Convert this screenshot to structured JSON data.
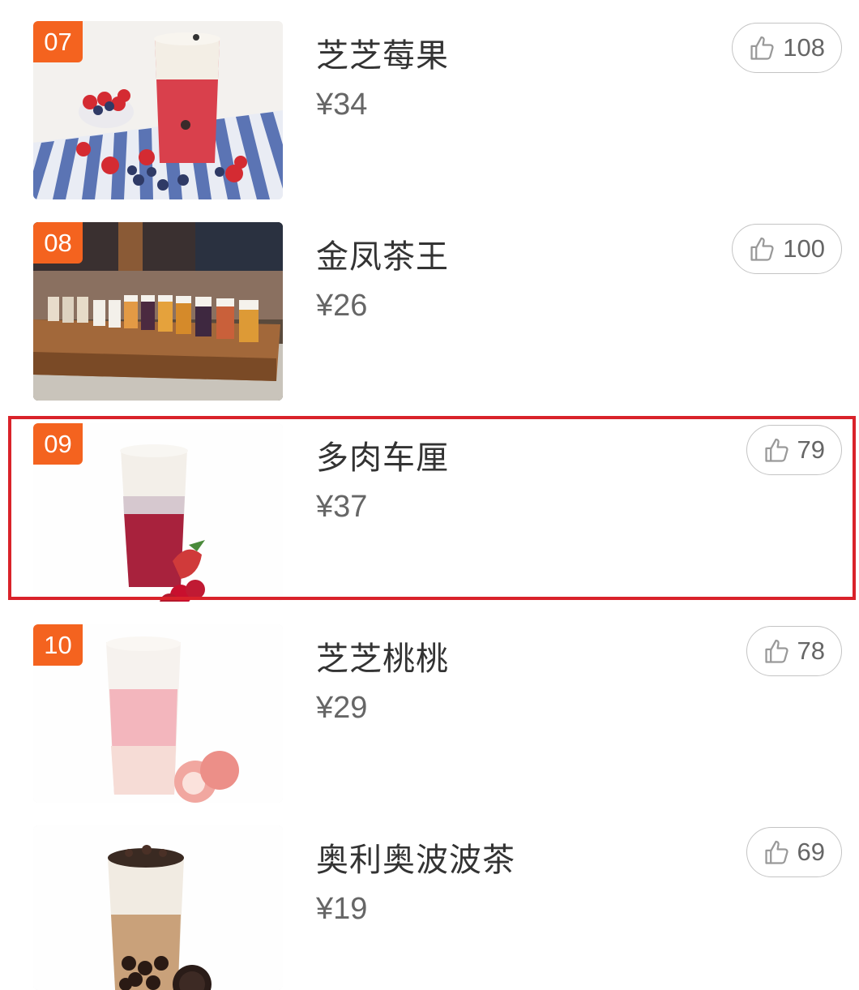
{
  "items": [
    {
      "rank": "07",
      "name": "芝芝莓果",
      "price": "¥34",
      "likes": "108",
      "image": "strawberry-blueberry-drink-photo"
    },
    {
      "rank": "08",
      "name": "金凤茶王",
      "price": "¥26",
      "likes": "100",
      "image": "tea-lineup-on-wooden-counter-photo"
    },
    {
      "rank": "09",
      "name": "多肉车厘",
      "price": "¥37",
      "likes": "79",
      "image": "cherry-drink-illustration"
    },
    {
      "rank": "10",
      "name": "芝芝桃桃",
      "price": "¥29",
      "likes": "78",
      "image": "peach-drink-illustration"
    },
    {
      "rank": "",
      "name": "奥利奥波波茶",
      "price": "¥19",
      "likes": "69",
      "image": "oreo-boba-tea-illustration"
    }
  ],
  "highlighted_item": "09",
  "colors": {
    "rank_badge": "#f4631f",
    "highlight_border": "#d9222a"
  },
  "icons": {
    "like": "thumbs-up-icon"
  }
}
